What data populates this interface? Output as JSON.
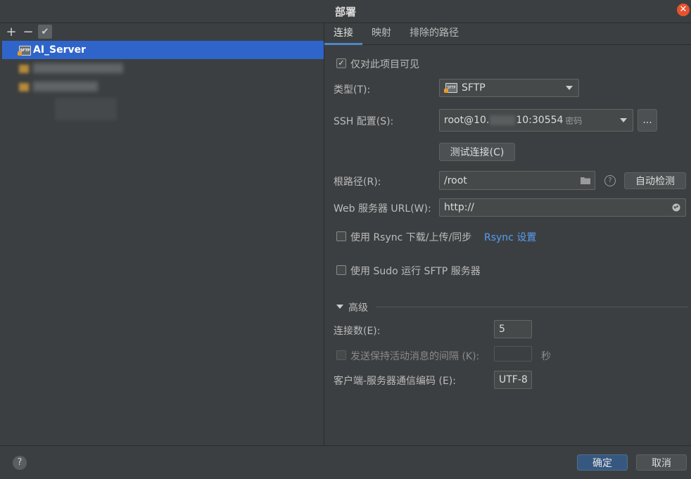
{
  "window": {
    "title": "部署"
  },
  "toolbar": {
    "add": "+",
    "remove": "−",
    "check": "✔"
  },
  "servers": [
    {
      "label": "AI_Server",
      "type": "SFTP"
    },
    {
      "label": ""
    },
    {
      "label": ""
    }
  ],
  "tabs": [
    "连接",
    "映射",
    "排除的路径"
  ],
  "connection": {
    "visible_only_label": "仅对此项目可见",
    "type_label": "类型(T):",
    "type_value": "SFTP",
    "ssh_label": "SSH 配置(S):",
    "ssh_prefix": "root@10.",
    "ssh_suffix": "10:30554",
    "ssh_auth": "密码",
    "ssh_more": "...",
    "test_button": "测试连接(C)",
    "root_label": "根路径(R):",
    "root_value": "/root",
    "autodetect": "自动检测",
    "url_label": "Web 服务器 URL(W):",
    "url_value": "http://",
    "rsync_label": "使用 Rsync 下载/上传/同步",
    "rsync_link": "Rsync 设置",
    "sudo_label": "使用 Sudo 运行 SFTP 服务器"
  },
  "advanced": {
    "title": "高级",
    "connections_label": "连接数(E):",
    "connections_value": "5",
    "keepalive_label": "发送保持活动消息的间隔 (K):",
    "keepalive_value": "",
    "seconds": "秒",
    "encoding_label": "客户端-服务器通信编码 (E):",
    "encoding_value": "UTF-8"
  },
  "footer": {
    "ok": "确定",
    "cancel": "取消",
    "help": "?"
  },
  "icons": {
    "close": "close-icon",
    "folder": "folder-icon",
    "globe": "globe-icon",
    "help": "question-icon",
    "chevron": "chevron-down-icon"
  },
  "colors": {
    "selection": "#2f65ca",
    "link": "#589df6",
    "primary_button": "#365880",
    "close": "#e5532d"
  }
}
